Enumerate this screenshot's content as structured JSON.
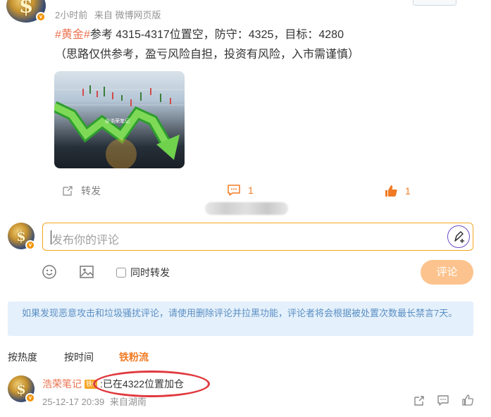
{
  "post": {
    "time": "2小时前",
    "source": "来自 微博网页版",
    "hashtag": "#黄金#",
    "text_line1": "参考 4315-4317位置空，防守：4325，目标：4280",
    "text_line2": "（思路仅供参考，盈亏风险自担，投资有风险，入市需谨慎）",
    "thumbnail_watermark": "@浩荣笔记"
  },
  "actions": {
    "repost_label": "转发",
    "comment_count": "1",
    "like_count": "1"
  },
  "composer": {
    "placeholder": "发布你的评论",
    "repost_checkbox_label": "同时转发",
    "submit_label": "评论"
  },
  "notice": {
    "text": "如果发现恶意攻击和垃圾骚扰评论，请使用删除评论并拉黑功能，评论者将会根据被处置次数最长禁言7天。"
  },
  "sort_tabs": [
    {
      "label": "按热度",
      "active": false
    },
    {
      "label": "按时间",
      "active": false
    },
    {
      "label": "铁粉流",
      "active": true
    }
  ],
  "comment": {
    "username": "浩荣笔记",
    "badge": "铁6",
    "text": ":已在4322位置加仓",
    "time": "25-12-17 20:39",
    "location": "来自湖南"
  },
  "colors": {
    "accent_orange": "#f07b24",
    "hashtag": "#eb7350",
    "annotation_red": "#e0393e",
    "notice_bg": "#e4f0fb"
  },
  "icons": [
    "repost-icon",
    "comment-icon",
    "like-icon",
    "emoji-icon",
    "image-icon",
    "pen-icon",
    "share-icon",
    "reply-icon",
    "thumb-up-icon"
  ]
}
